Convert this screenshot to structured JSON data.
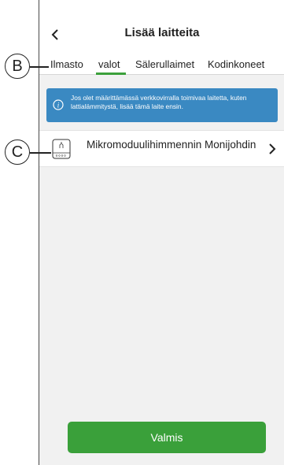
{
  "header": {
    "title": "Lisää laitteita",
    "back_icon": "chevron-left-icon"
  },
  "tabs": [
    {
      "label": "Ilmasto",
      "active": false
    },
    {
      "label": "valot",
      "active": true
    },
    {
      "label": "Sälerullaimet",
      "active": false
    },
    {
      "label": "Kodinkoneet",
      "active": false
    }
  ],
  "info_banner": {
    "icon": "info-icon",
    "text": "Jos olet määrittämässä verkkovirralla toimivaa laitetta, kuten lattialämmitystä, lisää tämä laite ensin."
  },
  "devices": [
    {
      "name": "Mikromoduulihimmennin Monijohdin",
      "icon": "dimmer-module-icon"
    }
  ],
  "done_button": {
    "label": "Valmis"
  },
  "callouts": {
    "b": "B",
    "c": "C"
  },
  "colors": {
    "accent": "#3ba03b",
    "info": "#3a89c2",
    "background": "#f1f1f1"
  }
}
